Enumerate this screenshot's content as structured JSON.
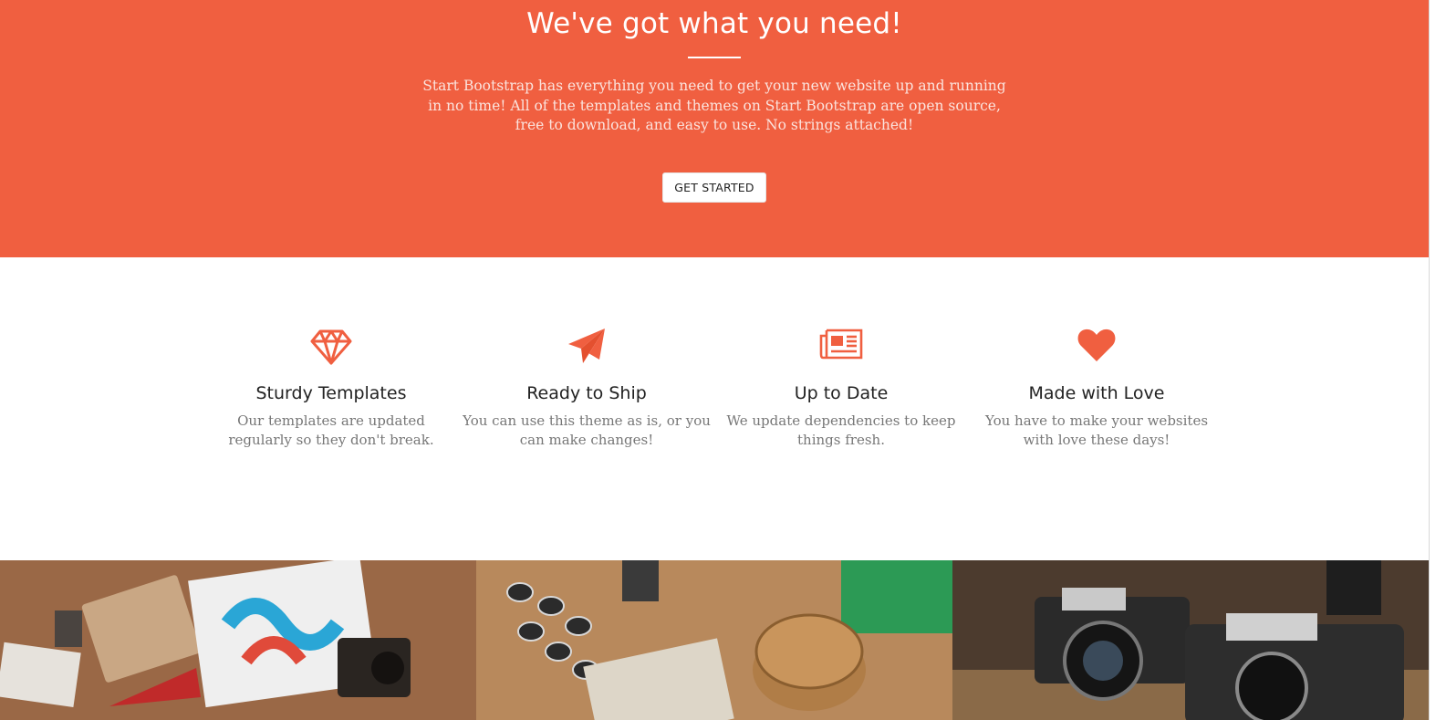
{
  "hero": {
    "title": "We've got what you need!",
    "text": "Start Bootstrap has everything you need to get your new website up and running in no time! All of the templates and themes on Start Bootstrap are open source, free to download, and easy to use. No strings attached!",
    "button_label": "GET STARTED"
  },
  "features": [
    {
      "icon": "diamond-icon",
      "title": "Sturdy Templates",
      "text": "Our templates are updated regularly so they don't break."
    },
    {
      "icon": "paper-plane-icon",
      "title": "Ready to Ship",
      "text": "You can use this theme as is, or you can make changes!"
    },
    {
      "icon": "newspaper-icon",
      "title": "Up to Date",
      "text": "We update dependencies to keep things fresh."
    },
    {
      "icon": "heart-icon",
      "title": "Made with Love",
      "text": "You have to make your websites with love these days!"
    }
  ],
  "colors": {
    "primary": "#f05f40",
    "text_dark": "#222222",
    "text_muted": "#777777"
  }
}
